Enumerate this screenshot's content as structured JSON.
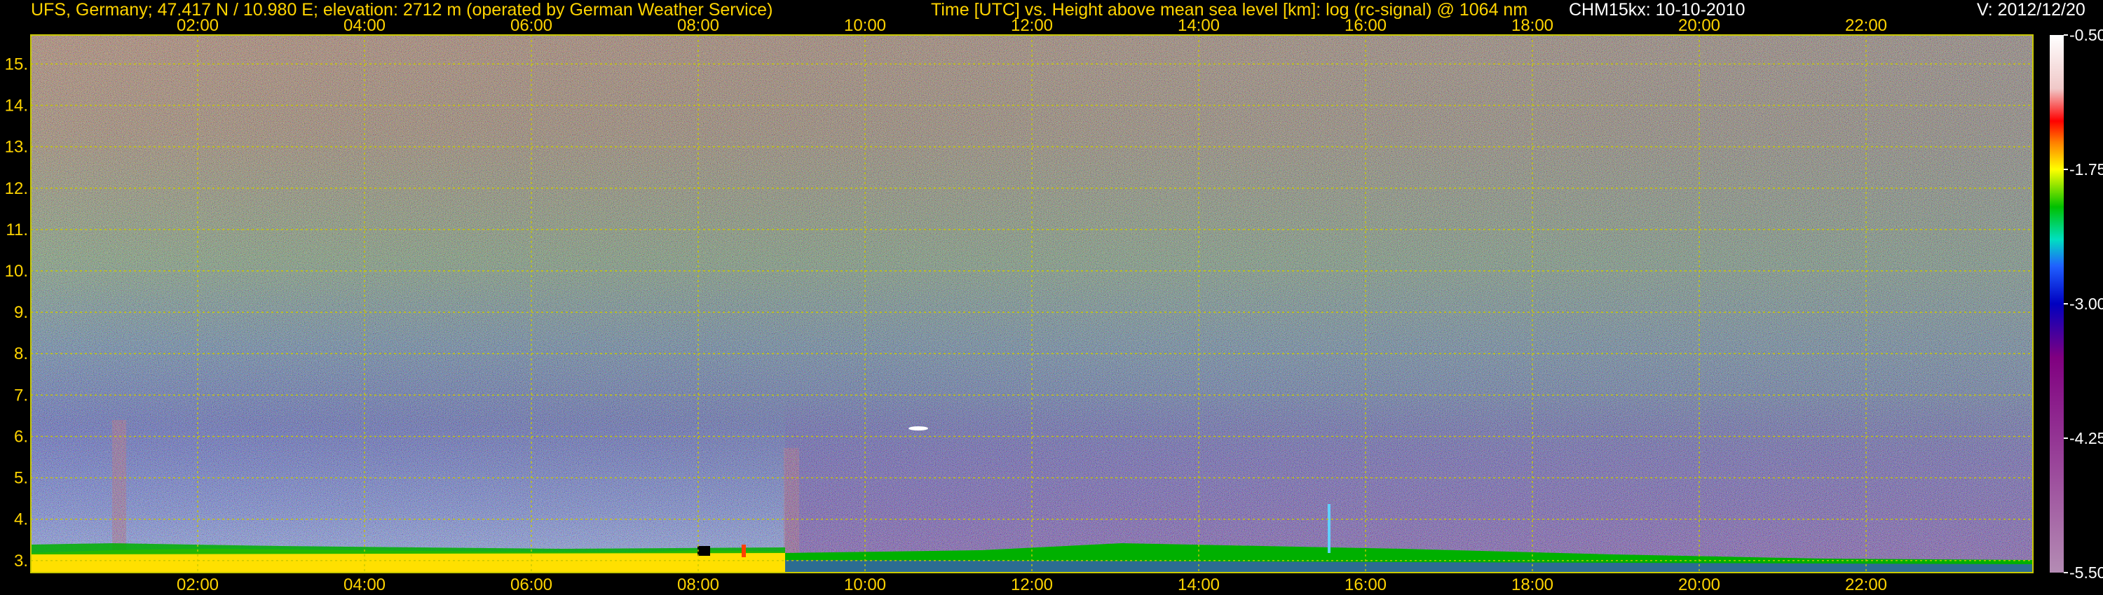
{
  "header": {
    "station": "UFS, Germany; 47.417 N / 10.980 E; elevation: 2712 m  (operated by German Weather Service)",
    "title": "Time [UTC] vs. Height above mean sea level [km]: log (rc-signal) @ 1064 nm",
    "instrument": "CHM15kx: 10-10-2010",
    "version": "V: 2012/12/20"
  },
  "chart_data": {
    "type": "heatmap",
    "title": "Time [UTC] vs. Height above mean sea level [km]: log (rc-signal) @ 1064 nm",
    "xlabel": "Time [UTC]",
    "ylabel": "Height above mean sea level [km]",
    "x_ticks": [
      "02:00",
      "04:00",
      "06:00",
      "08:00",
      "10:00",
      "12:00",
      "14:00",
      "16:00",
      "18:00",
      "20:00",
      "22:00"
    ],
    "x_tick_hours": [
      2,
      4,
      6,
      8,
      10,
      12,
      14,
      16,
      18,
      20,
      22
    ],
    "xlim_hours": [
      0,
      24
    ],
    "y_ticks": [
      "3.",
      "4.",
      "5.",
      "6.",
      "7.",
      "8.",
      "9.",
      "10.",
      "11.",
      "12.",
      "13.",
      "14.",
      "15."
    ],
    "y_tick_values": [
      3,
      4,
      5,
      6,
      7,
      8,
      9,
      10,
      11,
      12,
      13,
      14,
      15
    ],
    "ylim_km": [
      2.71,
      15.7
    ],
    "grid": true,
    "colorbar": {
      "label": "log (rc-signal)",
      "ticks": [
        "-0.50",
        "-1.75",
        "-3.00",
        "-4.25",
        "-5.50"
      ],
      "tick_values": [
        -0.5,
        -1.75,
        -3.0,
        -4.25,
        -5.5
      ],
      "range": [
        -5.5,
        -0.5
      ],
      "colors": [
        "#ffffff",
        "#f0c8c8",
        "#ff0000",
        "#ff8000",
        "#ffff00",
        "#00c000",
        "#00e0c0",
        "#2060ff",
        "#0000c0",
        "#800080",
        "#b48cb4"
      ]
    },
    "colors": {
      "grid": "#c8c800",
      "axis_text": "#ffd400",
      "boundary_layer_morning": "#ffe000",
      "boundary_layer_afternoon": "#00b000",
      "aerosol_layer": "#3c2aa0",
      "upper_noise": "#b0704a"
    }
  }
}
